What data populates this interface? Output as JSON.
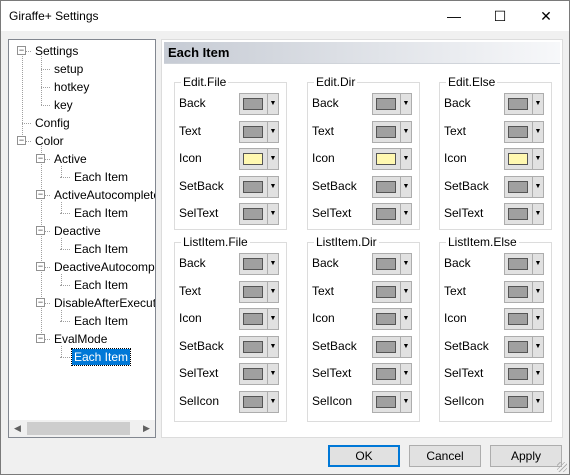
{
  "window": {
    "title": "Giraffe+ Settings"
  },
  "titlebar_buttons": {
    "minimize": "—",
    "maximize": "☐",
    "close": "✕"
  },
  "tree": [
    {
      "label": "Settings",
      "level": 0,
      "expander": "−"
    },
    {
      "label": "setup",
      "level": 1
    },
    {
      "label": "hotkey",
      "level": 1
    },
    {
      "label": "key",
      "level": 1
    },
    {
      "label": "Config",
      "level": 0
    },
    {
      "label": "Color",
      "level": 0,
      "expander": "−"
    },
    {
      "label": "Active",
      "level": 1,
      "expander": "−"
    },
    {
      "label": "Each Item",
      "level": 2
    },
    {
      "label": "ActiveAutocomplete",
      "level": 1,
      "expander": "−"
    },
    {
      "label": "Each Item",
      "level": 2
    },
    {
      "label": "Deactive",
      "level": 1,
      "expander": "−"
    },
    {
      "label": "Each Item",
      "level": 2
    },
    {
      "label": "DeactiveAutocomplete",
      "level": 1,
      "expander": "−"
    },
    {
      "label": "Each Item",
      "level": 2
    },
    {
      "label": "DisableAfterExecute",
      "level": 1,
      "expander": "−"
    },
    {
      "label": "Each Item",
      "level": 2
    },
    {
      "label": "EvalMode",
      "level": 1,
      "expander": "−"
    },
    {
      "label": "Each Item",
      "level": 2,
      "selected": true
    }
  ],
  "scroll": {
    "left_arrow": "◀",
    "right_arrow": "▶"
  },
  "panel": {
    "title": "Each Item"
  },
  "colors": {
    "gray": "#a0a0a0",
    "yellow": "#fff8b0",
    "accent": "#0078d7"
  },
  "groups": [
    {
      "title": "Edit.File",
      "rows": [
        {
          "label": "Back",
          "color": "#a0a0a0"
        },
        {
          "label": "Text",
          "color": "#a0a0a0"
        },
        {
          "label": "Icon",
          "color": "#fff8b0"
        },
        {
          "label": "SetBack",
          "color": "#a0a0a0"
        },
        {
          "label": "SelText",
          "color": "#a0a0a0"
        }
      ]
    },
    {
      "title": "Edit.Dir",
      "rows": [
        {
          "label": "Back",
          "color": "#a0a0a0"
        },
        {
          "label": "Text",
          "color": "#a0a0a0"
        },
        {
          "label": "Icon",
          "color": "#fff8b0"
        },
        {
          "label": "SetBack",
          "color": "#a0a0a0"
        },
        {
          "label": "SelText",
          "color": "#a0a0a0"
        }
      ]
    },
    {
      "title": "Edit.Else",
      "rows": [
        {
          "label": "Back",
          "color": "#a0a0a0"
        },
        {
          "label": "Text",
          "color": "#a0a0a0"
        },
        {
          "label": "Icon",
          "color": "#fff8b0"
        },
        {
          "label": "SetBack",
          "color": "#a0a0a0"
        },
        {
          "label": "SelText",
          "color": "#a0a0a0"
        }
      ]
    },
    {
      "title": "ListItem.File",
      "rows": [
        {
          "label": "Back",
          "color": "#a0a0a0"
        },
        {
          "label": "Text",
          "color": "#a0a0a0"
        },
        {
          "label": "Icon",
          "color": "#a0a0a0"
        },
        {
          "label": "SetBack",
          "color": "#a0a0a0"
        },
        {
          "label": "SelText",
          "color": "#a0a0a0"
        },
        {
          "label": "SelIcon",
          "color": "#a0a0a0"
        }
      ]
    },
    {
      "title": "ListItem.Dir",
      "rows": [
        {
          "label": "Back",
          "color": "#a0a0a0"
        },
        {
          "label": "Text",
          "color": "#a0a0a0"
        },
        {
          "label": "Icon",
          "color": "#a0a0a0"
        },
        {
          "label": "SetBack",
          "color": "#a0a0a0"
        },
        {
          "label": "SelText",
          "color": "#a0a0a0"
        },
        {
          "label": "SelIcon",
          "color": "#a0a0a0"
        }
      ]
    },
    {
      "title": "ListItem.Else",
      "rows": [
        {
          "label": "Back",
          "color": "#a0a0a0"
        },
        {
          "label": "Text",
          "color": "#a0a0a0"
        },
        {
          "label": "Icon",
          "color": "#a0a0a0"
        },
        {
          "label": "SetBack",
          "color": "#a0a0a0"
        },
        {
          "label": "SelText",
          "color": "#a0a0a0"
        },
        {
          "label": "SelIcon",
          "color": "#a0a0a0"
        }
      ]
    }
  ],
  "dropdown_glyph": "▼",
  "buttons": {
    "ok": "OK",
    "cancel": "Cancel",
    "apply": "Apply"
  }
}
